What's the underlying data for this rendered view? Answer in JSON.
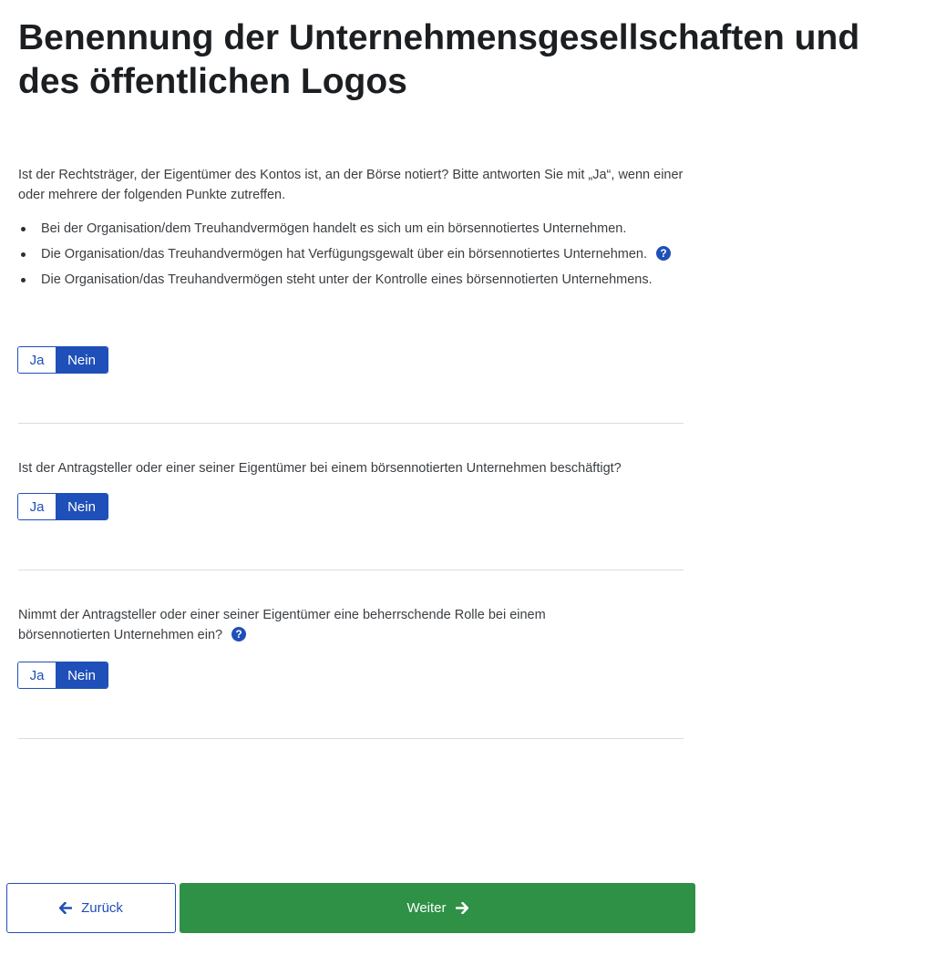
{
  "page": {
    "title": "Benennung der Unternehmensgesellschaften und des öffentlichen Logos"
  },
  "questions": [
    {
      "text": "Ist der Rechtsträger, der Eigentümer des Kontos ist, an der Börse notiert? Bitte antworten Sie mit „Ja“, wenn einer oder mehrere der folgenden Punkte zutreffen.",
      "bullets": [
        "Bei der Organisation/dem Treuhandvermögen handelt es sich um ein börsennotiertes Unternehmen.",
        "Die Organisation/das Treuhandvermögen hat Verfügungsgewalt über ein börsennotiertes Unternehmen.",
        "Die Organisation/das Treuhandvermögen steht unter der Kontrolle eines börsennotierten Unternehmens."
      ],
      "selected": "Nein"
    },
    {
      "text": "Ist der Antragsteller oder einer seiner Eigentümer bei einem börsennotierten Unternehmen beschäftigt?",
      "selected": "Nein"
    },
    {
      "text": "Nimmt der Antragsteller oder einer seiner Eigentümer eine beherrschende Rolle bei einem börsennotierten Unternehmen ein?",
      "selected": "Nein"
    }
  ],
  "toggle": {
    "yes_label": "Ja",
    "no_label": "Nein"
  },
  "help": {
    "icon": "question-circle-icon",
    "glyph": "?"
  },
  "footer": {
    "back_label": "Zurück",
    "next_label": "Weiter"
  },
  "colors": {
    "primary": "#1f4fb8",
    "success": "#2e9146",
    "divider": "#dcdcdc",
    "text": "#2b2f33"
  }
}
